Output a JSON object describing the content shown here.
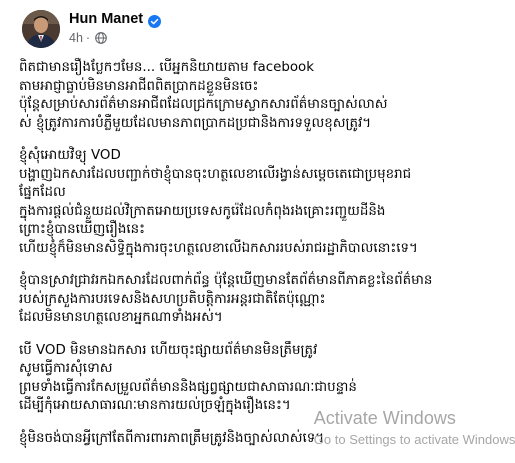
{
  "post": {
    "author": "Hun Manet",
    "time": "4h",
    "separator": "·",
    "paragraphs": [
      {
        "lines": [
          "ពិតជាមានរឿងប្លែកៗមែន... បើអ្នកនិយាយតាម facebook",
          "តាមអាជ្ញាធ្លាប់មិនមានអាជីពពិតប្រាកដខ្លួនមិនចេះ",
          "ប៉ុន្តែសម្រាប់សារព័ត៌មានអាជីពដែលជ្រកក្រោមស្លាកសារព័ត៌មានច្បាស់លាស់",
          "ស់ ខ្ញុំត្រូវការការបំភ្លឺមួយដែលមានភាពប្រាកដប្រជានិងការទទួលខុសត្រូវ។"
        ]
      },
      {
        "lines": [
          "ខ្ញុំសុំអោយវិទ្យុ VOD",
          "បង្ហាញឯកសារដែលបញ្ជាក់ថាខ្ញុំបានចុះហត្ថលេខាលើរង្វាន់សម្តេចតេជោប្រមុខរាជ",
          "ផ្នែកដែល",
          "ក្នុងការផ្តល់ជំនួយដល់វិក្រាតអោយប្រទេសកូរ៉េដែលកំពុងរងគ្រោះរញ្ជួយដីនិង",
          "ព្រោះខ្ញុំបានឃើញរឿងនេះ",
          "ហើយខ្ញុំក៏មិនមានសិទ្ធិក្នុងការចុះហត្ថលេខាលើឯកសាររបស់រាជរដ្ឋាភិបាលនោះទេ។"
        ]
      },
      {
        "lines": [
          "ខ្ញុំបានស្រាវជ្រាវរកឯកសារដែលពាក់ព័ន្ធ ប៉ុន្តែឃើញមានតែព័ត៌មានពីភាគខ្លះនៃព័ត៌មាន",
          "របស់ក្រសួងការបរទេសនិងសហប្រតិបត្តិការអន្តរជាតិតែប៉ុណ្ណោះ",
          "ដែលមិនមានហត្ថលេខាអ្នកណាទាំងអស់។"
        ]
      },
      {
        "lines": [
          "បើ VOD មិនមានឯកសារ ហើយចុះផ្សាយព័ត៌មានមិនត្រឹមត្រូវ",
          "សូមធ្វើការសុំទោស",
          "ព្រមទាំងធ្វើការកែសម្រួលព័ត៌មាននិងផ្សព្វផ្សាយជាសាធារណៈជាបន្ទាន់",
          "ដើម្បីកុំអោយសាធារណៈមានការយល់ច្រឡំក្នុងរឿងនេះ។"
        ]
      },
      {
        "lines": [
          "ខ្ញុំមិនចង់បានអ្វីក្រៅតែពីការពារភាពត្រឹមត្រូវនិងច្បាស់លាស់ទេ។"
        ]
      }
    ]
  },
  "watermark": {
    "title": "Activate Windows",
    "subtitle": "Go to Settings to activate Windows."
  }
}
